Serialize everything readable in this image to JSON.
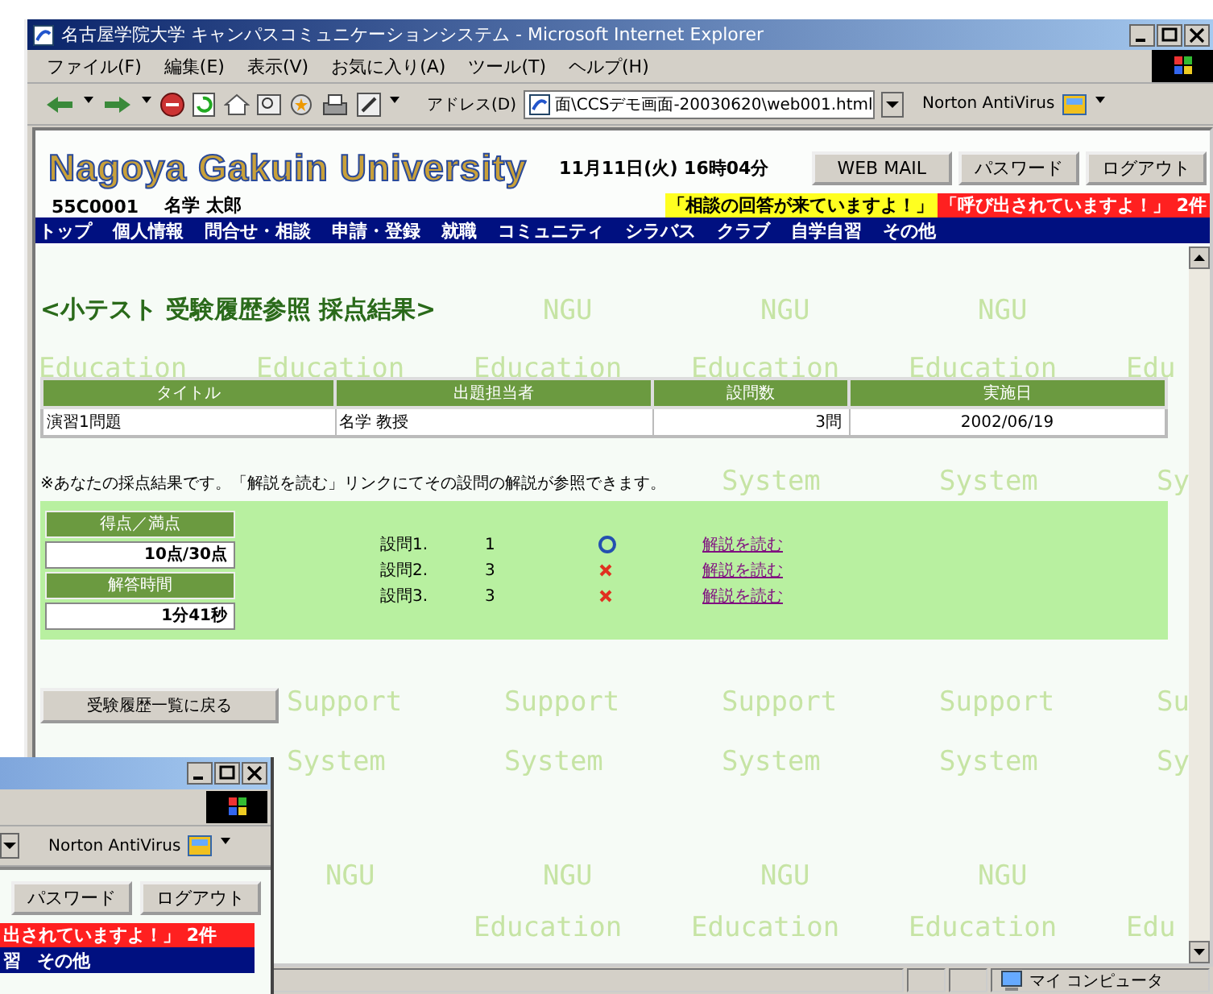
{
  "window": {
    "title": "名古屋学院大学 キャンパスコミュニケーションシステム - Microsoft Internet Explorer"
  },
  "menu": [
    "ファイル(F)",
    "編集(E)",
    "表示(V)",
    "お気に入り(A)",
    "ツール(T)",
    "ヘルプ(H)"
  ],
  "toolbar": {
    "address_label": "アドレス(D)",
    "address": "面\\CCSデモ画面-20030620\\web001.html",
    "norton": "Norton AntiVirus"
  },
  "header": {
    "logo": "Nagoya Gakuin University",
    "datetime": "11月11日(火) 16時04分",
    "buttons": [
      "WEB MAIL",
      "パスワード",
      "ログアウト"
    ],
    "user_id": "55C0001",
    "user_name": "名学 太郎",
    "notices": [
      {
        "kind": "info",
        "text": "「相談の回答が来ていますよ！」"
      },
      {
        "kind": "alert",
        "text": "「呼び出されていますよ！」 2件"
      }
    ],
    "nav": [
      "トップ",
      "個人情報",
      "問合せ・相談",
      "申請・登録",
      "就職",
      "コミュニティ",
      "シラバス",
      "クラブ",
      "自学自習",
      "その他"
    ]
  },
  "page": {
    "heading": "<小テスト 受験履歴参照 採点結果>",
    "table": {
      "columns": [
        "タイトル",
        "出題担当者",
        "設問数",
        "実施日"
      ],
      "rows": [
        [
          "演習1問題",
          "名学 教授",
          "3問",
          "2002/06/19"
        ]
      ]
    },
    "note": "※あなたの採点結果です。「解説を読む」リンクにてその設問の解説が参照できます。",
    "score": [
      {
        "label": "得点／満点",
        "value": "10点/30点"
      },
      {
        "label": "解答時間",
        "value": "1分41秒"
      }
    ],
    "questions": [
      {
        "label": "設問1.",
        "answer": "1",
        "correct": true,
        "link": "解説を読む"
      },
      {
        "label": "設問2.",
        "answer": "3",
        "correct": false,
        "link": "解説を読む"
      },
      {
        "label": "設問3.",
        "answer": "3",
        "correct": false,
        "link": "解説を読む"
      }
    ],
    "back_button": "受験履歴一覧に戻る"
  },
  "watermark": [
    {
      "kind": "inset",
      "words": [
        "NGU",
        "NGU",
        "NGU"
      ]
    },
    {
      "kind": "flush",
      "words": [
        "Education",
        "Education",
        "Education",
        "Education",
        "Education",
        "Edu"
      ]
    },
    {
      "kind": "shifted",
      "words": [
        "System",
        "System",
        "Sy"
      ]
    },
    {
      "kind": "shifted",
      "words": [
        "Support",
        "Support",
        "Support",
        "Support",
        "Su"
      ]
    },
    {
      "kind": "shifted",
      "words": [
        "System",
        "System",
        "System",
        "System",
        "Sy"
      ]
    },
    {
      "kind": "inset",
      "words": [
        "NGU",
        "NGU",
        "NGU",
        "NGU"
      ]
    },
    {
      "kind": "flush",
      "words": [
        "Education",
        "Education",
        "Education",
        "Edu"
      ]
    }
  ],
  "status_bar": {
    "zone": "マイ コンピュータ"
  },
  "second_window": {
    "norton": "Norton AntiVirus",
    "buttons": [
      "パスワード",
      "ログアウト"
    ],
    "notice": "出されていますよ！」 2件",
    "nav": [
      "習",
      "その他"
    ]
  }
}
